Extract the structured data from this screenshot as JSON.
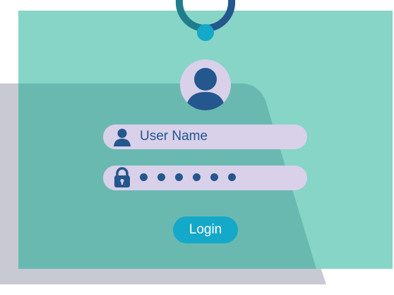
{
  "login_form": {
    "username_placeholder": "User Name",
    "password_masked_length": 6,
    "login_label": "Login"
  },
  "icons": {
    "avatar": "user-avatar-icon",
    "username": "user-icon",
    "password": "lock-icon",
    "hanger": "hanger-ring-icon"
  },
  "colors": {
    "panel": "#86d5c7",
    "shadow_panel": "#6ab9b1",
    "back_card": "#c9c9d4",
    "field": "#d9d0ea",
    "accent_dark": "#23578d",
    "button": "#14a8c9"
  }
}
